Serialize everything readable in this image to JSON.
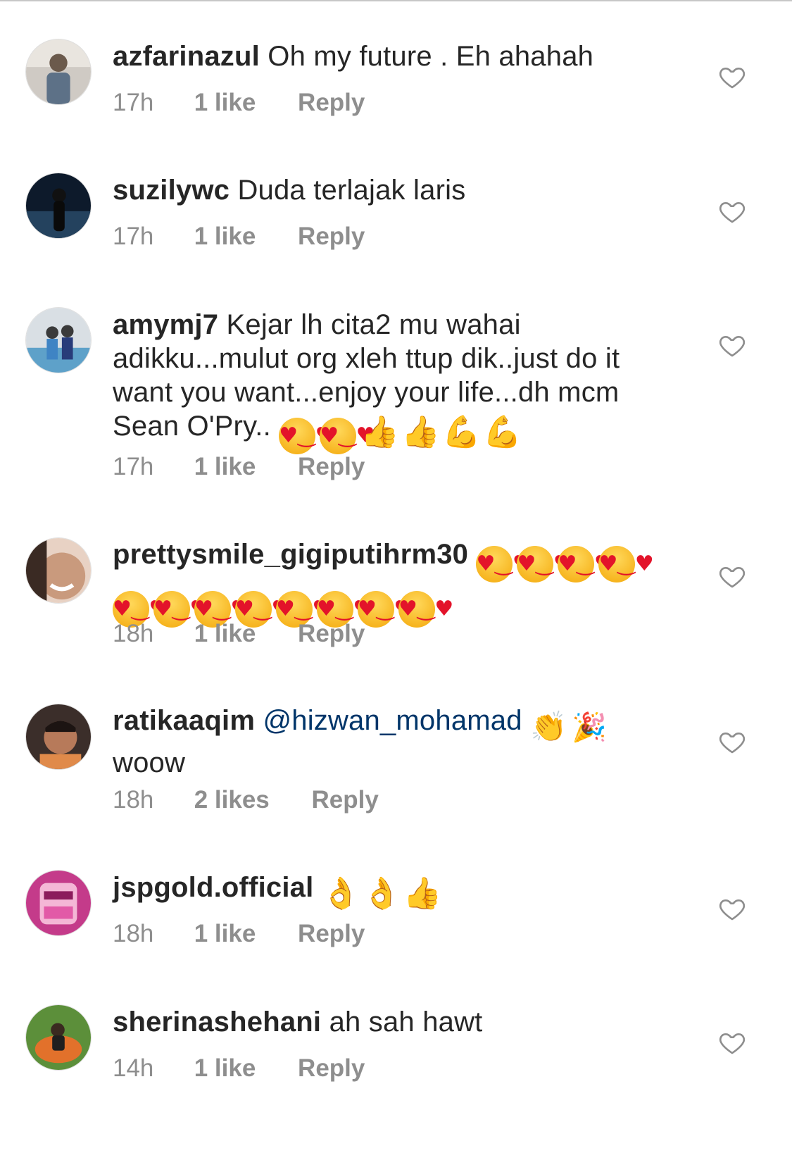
{
  "comments": [
    {
      "username": "azfarinazul",
      "text": "Oh my future . Eh ahahah",
      "time": "17h",
      "likes": "1 like",
      "reply": "Reply"
    },
    {
      "username": "suzilywc",
      "text": "Duda terlajak laris",
      "time": "17h",
      "likes": "1 like",
      "reply": "Reply"
    },
    {
      "username": "amymj7",
      "text": "Kejar lh cita2 mu wahai adikku...mulut org xleh ttup dik..just do it want you want...enjoy your life...dh mcm Sean O'Pry..",
      "time": "17h",
      "likes": "1 like",
      "reply": "Reply"
    },
    {
      "username": "prettysmile_gigiputihrm30",
      "text": "",
      "time": "18h",
      "likes": "1 like",
      "reply": "Reply"
    },
    {
      "username": "ratikaaqim",
      "mention": "@hizwan_mohamad",
      "text": "woow",
      "time": "18h",
      "likes": "2 likes",
      "reply": "Reply"
    },
    {
      "username": "jspgold.official",
      "text": "",
      "time": "18h",
      "likes": "1 like",
      "reply": "Reply"
    },
    {
      "username": "sherinashehani",
      "text": "ah sah hawt",
      "time": "14h",
      "likes": "1 like",
      "reply": "Reply"
    }
  ],
  "emoji": {
    "heart_eyes": "♥‿♥",
    "thumbs_up": "👍",
    "ok_hand": "👌",
    "muscle": "💪",
    "clap": "👏",
    "party": "🎉"
  },
  "icons": {
    "heart": "heart-outline-icon"
  },
  "colors": {
    "username": "#262626",
    "meta": "#8e8e8e",
    "mention": "#003569",
    "heart_stroke": "#8e8e8e"
  }
}
